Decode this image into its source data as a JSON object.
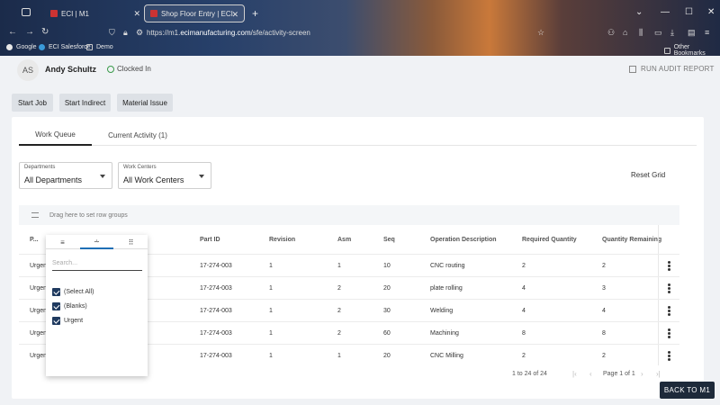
{
  "browser": {
    "tabs": [
      {
        "title": "ECI | M1"
      },
      {
        "title": "Shop Floor Entry | ECI"
      }
    ],
    "url_host": "https://m1.",
    "url_domain": "ecimanufacturing.com",
    "url_path": "/sfe/activity-screen",
    "bookmarks": [
      "Google",
      "ECI Salesforce",
      "Demo"
    ],
    "other_bookmarks": "Other Bookmarks"
  },
  "header": {
    "avatar_initials": "AS",
    "user_name": "Andy Schultz",
    "status": "Clocked In",
    "audit_label": "RUN AUDIT REPORT"
  },
  "actions": {
    "start_job": "Start Job",
    "start_indirect": "Start Indirect",
    "material_issue": "Material Issue"
  },
  "tabs": {
    "work_queue": "Work Queue",
    "current_activity": "Current Activity (1)"
  },
  "filters": {
    "departments_label": "Departments",
    "departments_value": "All Departments",
    "workcenters_label": "Work Centers",
    "workcenters_value": "All Work Centers",
    "reset_grid": "Reset Grid"
  },
  "grid": {
    "group_hint": "Drag here to set row groups",
    "columns": {
      "priority": "P...",
      "part_id": "Part ID",
      "revision": "Revision",
      "asm": "Asm",
      "seq": "Seq",
      "operation": "Operation Description",
      "required": "Required Quantity",
      "remaining": "Quantity Remaining"
    },
    "rows": [
      {
        "priority": "Urgent",
        "part_id": "17-274-003",
        "revision": "1",
        "asm": "1",
        "seq": "10",
        "operation": "CNC routing",
        "required": "2",
        "remaining": "2"
      },
      {
        "priority": "Urgent",
        "part_id": "17-274-003",
        "revision": "1",
        "asm": "2",
        "seq": "20",
        "operation": "plate rolling",
        "required": "4",
        "remaining": "3"
      },
      {
        "priority": "Urgent",
        "part_id": "17-274-003",
        "revision": "1",
        "asm": "2",
        "seq": "30",
        "operation": "Welding",
        "required": "4",
        "remaining": "4"
      },
      {
        "priority": "Urgent",
        "part_id": "17-274-003",
        "revision": "1",
        "asm": "2",
        "seq": "60",
        "operation": "Machining",
        "required": "8",
        "remaining": "8"
      },
      {
        "priority": "Urgent",
        "part_id": "17-274-003",
        "revision": "1",
        "asm": "1",
        "seq": "20",
        "operation": "CNC Milling",
        "required": "2",
        "remaining": "2"
      }
    ],
    "range_text": "1 to 24 of 24",
    "page_text": "Page 1 of 1"
  },
  "filter_popup": {
    "search_placeholder": "Search...",
    "options": [
      "(Select All)",
      "(Blanks)",
      "Urgent"
    ]
  },
  "back_button": "BACK TO M1"
}
